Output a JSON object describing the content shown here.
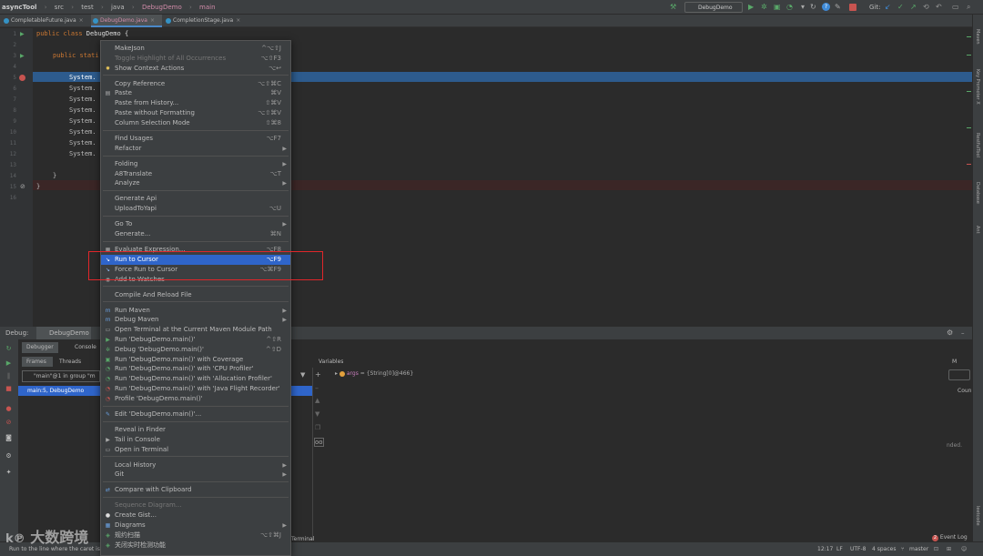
{
  "nav": {
    "project": "asyncTool",
    "crumbs": [
      "src",
      "test",
      "java",
      "DebugDemo",
      "main"
    ],
    "run_config": "DebugDemo",
    "git_label": "Git:"
  },
  "tabs": [
    {
      "label": "CompletableFuture.java"
    },
    {
      "label": "DebugDemo.java"
    },
    {
      "label": "CompletionStage.java"
    }
  ],
  "editor": {
    "lines": [
      "1",
      "2",
      "3",
      "4",
      "5",
      "6",
      "7",
      "8",
      "9",
      "10",
      "11",
      "12",
      "13",
      "14",
      "15",
      "16"
    ],
    "line1_kw": "public class",
    "line1_name": "DebugDemo {",
    "line3_kw": "public stati",
    "sys": [
      "System.",
      "System.",
      "System.",
      "System.",
      "System.",
      "System.",
      "System.",
      "System."
    ],
    "close1": "}",
    "close2": "}"
  },
  "menu": {
    "items": [
      {
        "label": "MakeJson",
        "sc": "^⌥⇧J"
      },
      {
        "label": "Toggle Highlight of All Occurrences",
        "sc": "⌥⇧F3",
        "dis": true
      },
      {
        "label": "Show Context Actions",
        "sc": "⌥↩",
        "icon": "bulb-icon"
      },
      {
        "sep": true
      },
      {
        "label": "Copy Reference",
        "sc": "⌥⇧⌘C"
      },
      {
        "label": "Paste",
        "sc": "⌘V",
        "icon": "paste-icon"
      },
      {
        "label": "Paste from History...",
        "sc": "⇧⌘V"
      },
      {
        "label": "Paste without Formatting",
        "sc": "⌥⇧⌘V"
      },
      {
        "label": "Column Selection Mode",
        "sc": "⇧⌘8"
      },
      {
        "sep": true
      },
      {
        "label": "Find Usages",
        "sc": "⌥F7"
      },
      {
        "label": "Refactor",
        "arr": true
      },
      {
        "sep": true
      },
      {
        "label": "Folding",
        "arr": true
      },
      {
        "label": "A8Translate",
        "sc": "⌥T"
      },
      {
        "label": "Analyze",
        "arr": true
      },
      {
        "sep": true
      },
      {
        "label": "Generate Api"
      },
      {
        "label": "UploadToYapi",
        "sc": "⌥U"
      },
      {
        "sep": true
      },
      {
        "label": "Go To",
        "arr": true
      },
      {
        "label": "Generate...",
        "sc": "⌘N"
      },
      {
        "sep": true
      },
      {
        "label": "Evaluate Expression...",
        "sc": "⌥F8",
        "icon": "calc-icon"
      },
      {
        "label": "Run to Cursor",
        "sc": "⌥F9",
        "sel": true,
        "icon": "run-cursor-icon"
      },
      {
        "label": "Force Run to Cursor",
        "sc": "⌥⌘F9",
        "icon": "force-run-icon"
      },
      {
        "label": "Add to Watches",
        "icon": "watch-icon"
      },
      {
        "sep": true
      },
      {
        "label": "Compile And Reload File"
      },
      {
        "sep": true
      },
      {
        "label": "Run Maven",
        "arr": true,
        "icon": "maven-icon"
      },
      {
        "label": "Debug Maven",
        "arr": true,
        "icon": "maven-icon"
      },
      {
        "label": "Open Terminal at the Current Maven Module Path",
        "icon": "terminal-icon"
      },
      {
        "label": "Run 'DebugDemo.main()'",
        "sc": "^⇧R",
        "icon": "run-icon"
      },
      {
        "label": "Debug 'DebugDemo.main()'",
        "sc": "^⇧D",
        "icon": "debug-icon"
      },
      {
        "label": "Run 'DebugDemo.main()' with Coverage",
        "icon": "coverage-icon"
      },
      {
        "label": "Run 'DebugDemo.main()' with 'CPU Profiler'",
        "icon": "cpu-icon"
      },
      {
        "label": "Run 'DebugDemo.main()' with 'Allocation Profiler'",
        "icon": "alloc-icon"
      },
      {
        "label": "Run 'DebugDemo.main()' with 'Java Flight Recorder'",
        "icon": "jfr-icon"
      },
      {
        "label": "Profile 'DebugDemo.main()'",
        "icon": "profile-icon"
      },
      {
        "sep": true
      },
      {
        "label": "Edit 'DebugDemo.main()'...",
        "icon": "edit-icon"
      },
      {
        "sep": true
      },
      {
        "label": "Reveal in Finder"
      },
      {
        "label": "Tail in Console",
        "icon": "tail-icon"
      },
      {
        "label": "Open in Terminal",
        "icon": "terminal-icon"
      },
      {
        "sep": true
      },
      {
        "label": "Local History",
        "arr": true
      },
      {
        "label": "Git",
        "arr": true
      },
      {
        "sep": true
      },
      {
        "label": "Compare with Clipboard",
        "icon": "compare-icon"
      },
      {
        "sep": true
      },
      {
        "label": "Sequence Diagram...",
        "dis": true
      },
      {
        "label": "Create Gist...",
        "icon": "github-icon"
      },
      {
        "label": "Diagrams",
        "arr": true,
        "icon": "diagram-icon"
      },
      {
        "label": "规约扫描",
        "sc": "⌥⇧⌘J",
        "icon": "scan-icon"
      },
      {
        "label": "关闭实时检测功能",
        "icon": "detect-icon"
      }
    ]
  },
  "debug": {
    "label": "Debug:",
    "tab": "DebugDemo",
    "subtab_debugger": "Debugger",
    "subtab_console": "Console",
    "frames": "Frames",
    "threads": "Threads",
    "thread_sel": "\"main\"@1 in group \"m",
    "frame_row": "main:5, DebugDemo",
    "variables": "Variables",
    "var_name": "args",
    "var_value": "= {String[0]@466}",
    "right_m": "M",
    "right_coun": "Coun",
    "right_ended": "nded.",
    "terminal": "Terminal"
  },
  "statusbar": {
    "hint": "Run to the line where the caret is",
    "time": "12:17",
    "lf": "LF",
    "enc": "UTF-8",
    "indent": "4 spaces",
    "branch": "master",
    "event_log": "Event Log",
    "event_count": "2"
  },
  "sidebar": {
    "maven": "Maven",
    "keypromoter": "Key Promoter X",
    "restful": "RestfulTool",
    "database": "Database",
    "ant": "Ant",
    "leetcode": "leetcode"
  },
  "watermark": "大数跨境"
}
